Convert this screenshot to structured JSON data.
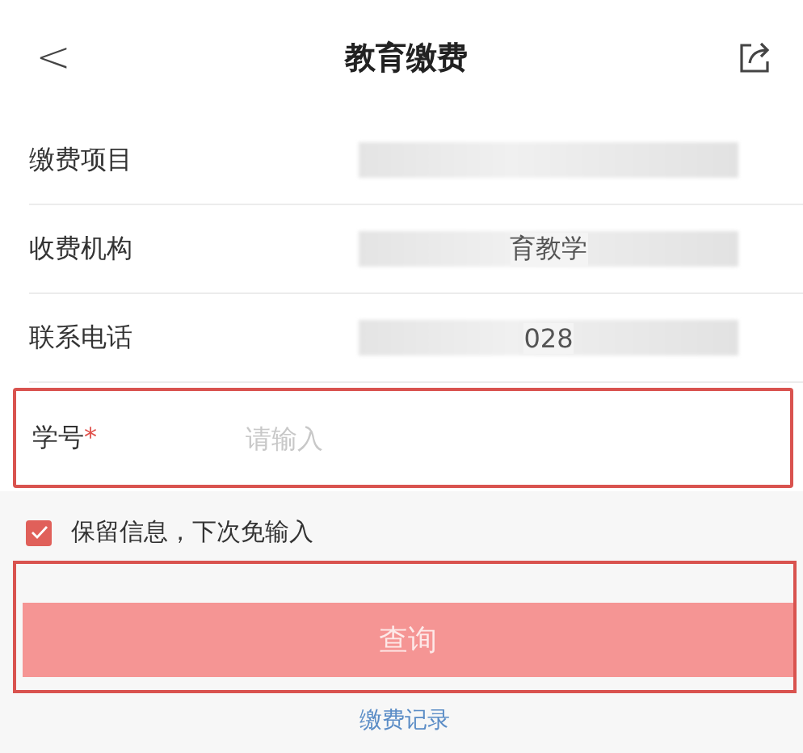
{
  "header": {
    "back": "<",
    "title": "教育缴费"
  },
  "info_rows": [
    {
      "label": "缴费项目",
      "value": "",
      "blurred": true
    },
    {
      "label": "收费机构",
      "value": "育教学",
      "blurred": true
    },
    {
      "label": "联系电话",
      "value": "028",
      "blurred": true
    }
  ],
  "student_field": {
    "label": "学号",
    "required_mark": "*",
    "placeholder": "请输入",
    "highlighted": true
  },
  "remember": {
    "label": "保留信息，下次免输入",
    "checked": true
  },
  "query_button": {
    "label": "查询",
    "highlighted": true
  },
  "records_link": "缴费记录"
}
